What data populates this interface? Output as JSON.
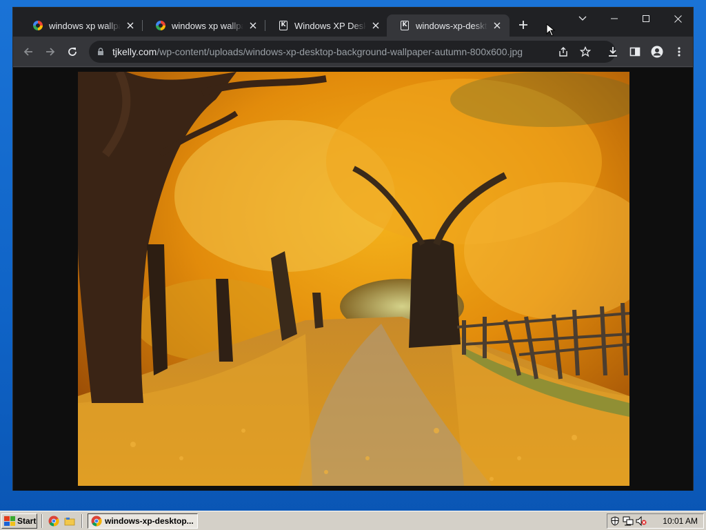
{
  "browser": {
    "tabs": [
      {
        "title": "windows xp wallpaper",
        "favicon": "google-icon",
        "active": false
      },
      {
        "title": "windows xp wallpaper",
        "favicon": "google-icon",
        "active": false
      },
      {
        "title": "Windows XP Desktop",
        "favicon": "tjkelly-icon",
        "active": false
      },
      {
        "title": "windows-xp-desktop",
        "favicon": "tjkelly-icon",
        "active": true
      }
    ],
    "url_host": "tjkelly.com",
    "url_path": "/wp-content/uploads/windows-xp-desktop-background-wallpaper-autumn-800x600.jpg",
    "image_description": "autumn tree-lined path with fallen leaves"
  },
  "taskbar": {
    "start_label": "Start",
    "task_button_label": "windows-xp-desktop...",
    "clock": "10:01 AM"
  },
  "colors": {
    "tab_bg": "#202124",
    "toolbar_bg": "#35363a",
    "desktop_blue": "#0f63c6",
    "taskbar_gray": "#d4d0c8"
  }
}
